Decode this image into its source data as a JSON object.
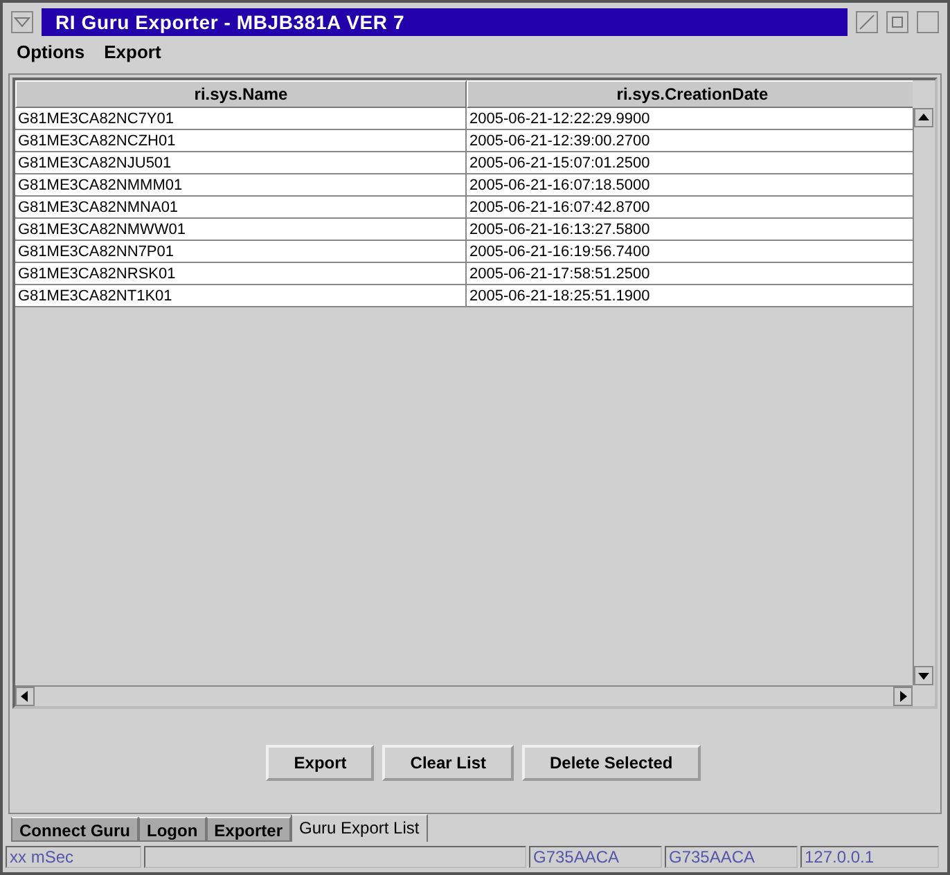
{
  "window": {
    "title": "RI Guru Exporter - MBJB381A  VER 7"
  },
  "menu": [
    "Options",
    "Export"
  ],
  "table": {
    "columns": [
      "ri.sys.Name",
      "ri.sys.CreationDate"
    ],
    "rows": [
      [
        "G81ME3CA82NC7Y01",
        "2005-06-21-12:22:29.9900"
      ],
      [
        "G81ME3CA82NCZH01",
        "2005-06-21-12:39:00.2700"
      ],
      [
        "G81ME3CA82NJU501",
        "2005-06-21-15:07:01.2500"
      ],
      [
        "G81ME3CA82NMMM01",
        "2005-06-21-16:07:18.5000"
      ],
      [
        "G81ME3CA82NMNA01",
        "2005-06-21-16:07:42.8700"
      ],
      [
        "G81ME3CA82NMWW01",
        "2005-06-21-16:13:27.5800"
      ],
      [
        "G81ME3CA82NN7P01",
        "2005-06-21-16:19:56.7400"
      ],
      [
        "G81ME3CA82NRSK01",
        "2005-06-21-17:58:51.2500"
      ],
      [
        "G81ME3CA82NT1K01",
        "2005-06-21-18:25:51.1900"
      ]
    ]
  },
  "buttons": [
    "Export",
    "Clear List",
    "Delete Selected"
  ],
  "tabs": [
    {
      "label": "Connect Guru",
      "selected": false
    },
    {
      "label": "Logon",
      "selected": false
    },
    {
      "label": "Exporter",
      "selected": false
    },
    {
      "label": "Guru Export List",
      "selected": true
    }
  ],
  "status_bar": [
    "xx mSec",
    "G735AACA",
    "G735AACA",
    "127.0.0.1"
  ]
}
